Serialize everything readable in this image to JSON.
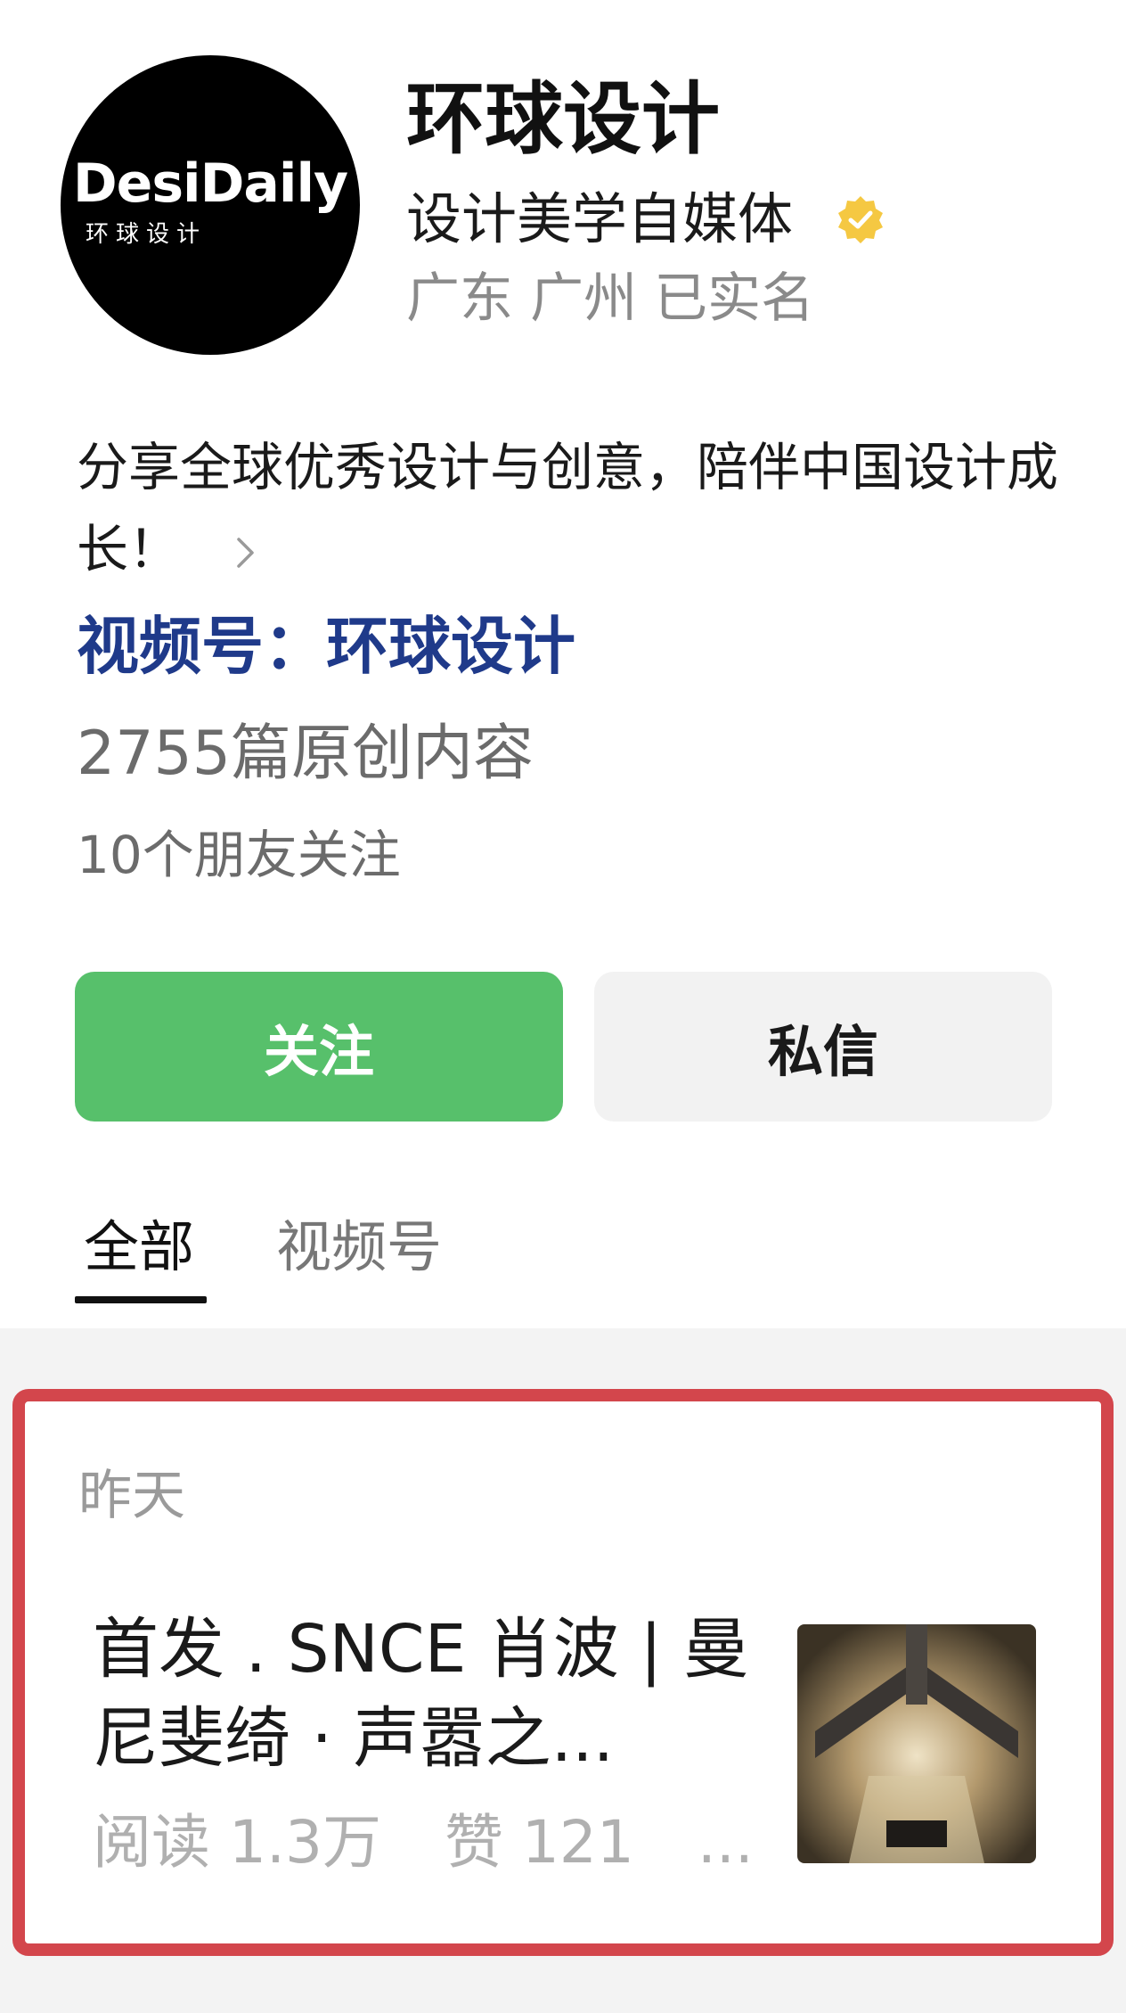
{
  "profile": {
    "logo_text": "DesiDaily",
    "logo_subtext": "环球设计",
    "name": "环球设计",
    "subtitle": "设计美学自媒体",
    "location": "广东 广州 已实名",
    "bio": "分享全球优秀设计与创意，陪伴中国设计成长！",
    "channel_link": "视频号：环球设计",
    "original_count": "2755篇原创内容",
    "friends_follow": "10个朋友关注",
    "verified_icon": "verified-badge-icon",
    "colors": {
      "accent": "#57c06b",
      "link": "#1f3a8a",
      "badge": "#f5c842"
    }
  },
  "actions": {
    "follow_label": "关注",
    "message_label": "私信"
  },
  "tabs": [
    {
      "label": "全部",
      "active": true
    },
    {
      "label": "视频号",
      "active": false
    }
  ],
  "feed": {
    "date": "昨天",
    "article": {
      "title": "首发 . SNCE 肖波 | 曼尼斐绮 · 声嚣之...",
      "reads": "阅读 1.3万",
      "likes": "赞 121",
      "more": "..."
    },
    "highlight_color": "#d3464c"
  }
}
